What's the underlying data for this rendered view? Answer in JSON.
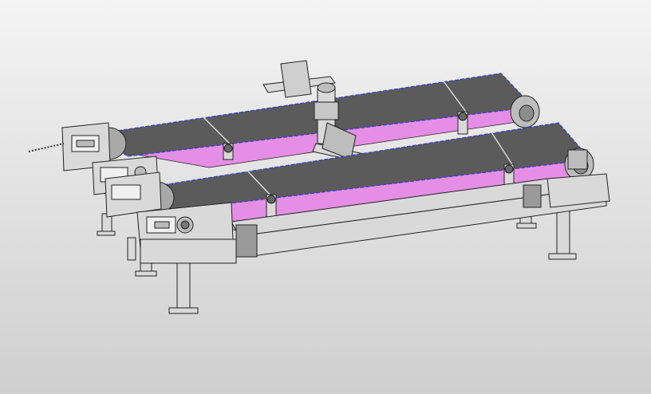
{
  "model": {
    "name": "",
    "components": {
      "conveyors": [
        {
          "id": "rear-conveyor"
        },
        {
          "id": "front-conveyor"
        }
      ],
      "robot": {
        "id": "mast-manipulator"
      }
    }
  },
  "colors": {
    "background_top": "#f4f4f4",
    "background_bottom": "#cfcfcf",
    "belt": "#5b5b5b",
    "belt_edge": "#3a3ad0",
    "frame_interior": "#e58ee5",
    "steel": "#d9d9d9",
    "steel_dark": "#9a9a9a",
    "outline": "#222222"
  }
}
